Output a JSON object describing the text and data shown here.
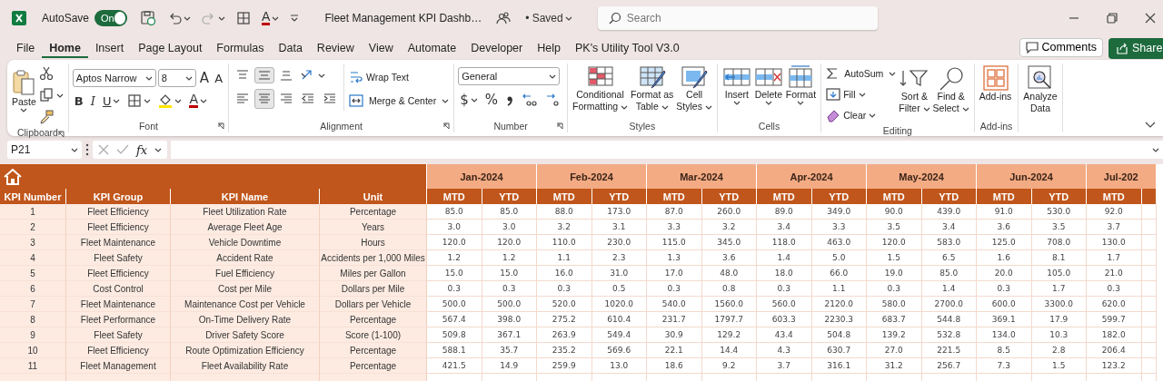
{
  "title_bar": {
    "autosave": {
      "label": "AutoSave",
      "on": true,
      "state_text": "On"
    },
    "font_color": "A",
    "document_title": "Fleet Management KPI Dashb…",
    "save_status": "• Saved",
    "search": {
      "placeholder": "Search"
    }
  },
  "menu_tabs": [
    {
      "label": "File",
      "selected": false
    },
    {
      "label": "Home",
      "selected": true
    },
    {
      "label": "Insert",
      "selected": false
    },
    {
      "label": "Page Layout",
      "selected": false
    },
    {
      "label": "Formulas",
      "selected": false
    },
    {
      "label": "Data",
      "selected": false
    },
    {
      "label": "Review",
      "selected": false
    },
    {
      "label": "View",
      "selected": false
    },
    {
      "label": "Automate",
      "selected": false
    },
    {
      "label": "Developer",
      "selected": false
    },
    {
      "label": "Help",
      "selected": false
    },
    {
      "label": "PK's Utility Tool V3.0",
      "selected": false
    }
  ],
  "comments_button": "Comments",
  "share_button": "Share",
  "ribbon": {
    "clipboard": {
      "label": "Clipboard",
      "paste": "Paste"
    },
    "font": {
      "label": "Font",
      "font_name": "Aptos Narrow",
      "font_size": "8",
      "grow": "A",
      "shrink": "A",
      "bold": "B",
      "italic": "I",
      "underline": "U",
      "font_color": "A"
    },
    "alignment": {
      "label": "Alignment",
      "vertical": [
        {
          "selected": false
        },
        {
          "selected": true
        },
        {
          "selected": false
        }
      ],
      "horizontal": [
        {
          "selected": false
        },
        {
          "selected": true
        },
        {
          "selected": false
        }
      ],
      "wrap_text": "Wrap Text",
      "merge_center": "Merge & Center"
    },
    "number": {
      "label": "Number",
      "format": "General",
      "currency": "$",
      "percent": "%"
    },
    "styles": {
      "label": "Styles",
      "buttons": [
        "Conditional\nFormatting",
        "Format as\nTable",
        "Cell\nStyles"
      ]
    },
    "cells": {
      "label": "Cells",
      "buttons": [
        "Insert",
        "Delete",
        "Format"
      ]
    },
    "editing": {
      "label": "Editing",
      "autosum": "AutoSum",
      "fill": "Fill",
      "clear": "Clear",
      "buttons": [
        "Sort &\nFilter",
        "Find &\nSelect"
      ]
    },
    "addins": {
      "label": "Add-ins",
      "button": "Add-ins"
    },
    "analyze": {
      "button": "Analyze\nData"
    }
  },
  "formula_bar": {
    "name_box": "P21",
    "fx": "fx"
  },
  "sheet": {
    "columns": [
      "KPI Number",
      "KPI Group",
      "KPI Name",
      "Unit"
    ],
    "months": [
      {
        "label": "Jan-2024",
        "columns": [
          "MTD",
          "YTD"
        ]
      },
      {
        "label": "Feb-2024",
        "columns": [
          "MTD",
          "YTD"
        ]
      },
      {
        "label": "Mar-2024",
        "columns": [
          "MTD",
          "YTD"
        ]
      },
      {
        "label": "Apr-2024",
        "columns": [
          "MTD",
          "YTD"
        ]
      },
      {
        "label": "May-2024",
        "columns": [
          "MTD",
          "YTD"
        ]
      },
      {
        "label": "Jun-2024",
        "columns": [
          "MTD",
          "YTD"
        ]
      },
      {
        "label": "Jul-202",
        "columns": [
          "MTD"
        ]
      }
    ],
    "rows": [
      {
        "number": "1",
        "group": "Fleet Efficiency",
        "name": "Fleet Utilization Rate",
        "unit": "Percentage",
        "values": [
          "85.0",
          "85.0",
          "88.0",
          "173.0",
          "87.0",
          "260.0",
          "89.0",
          "349.0",
          "90.0",
          "439.0",
          "91.0",
          "530.0",
          "92.0"
        ]
      },
      {
        "number": "2",
        "group": "Fleet Efficiency",
        "name": "Average Fleet Age",
        "unit": "Years",
        "values": [
          "3.0",
          "3.0",
          "3.2",
          "3.1",
          "3.3",
          "3.2",
          "3.4",
          "3.3",
          "3.5",
          "3.4",
          "3.6",
          "3.5",
          "3.7"
        ]
      },
      {
        "number": "3",
        "group": "Fleet Maintenance",
        "name": "Vehicle Downtime",
        "unit": "Hours",
        "values": [
          "120.0",
          "120.0",
          "110.0",
          "230.0",
          "115.0",
          "345.0",
          "118.0",
          "463.0",
          "120.0",
          "583.0",
          "125.0",
          "708.0",
          "130.0"
        ]
      },
      {
        "number": "4",
        "group": "Fleet Safety",
        "name": "Accident Rate",
        "unit": "Accidents per 1,000 Miles",
        "values": [
          "1.2",
          "1.2",
          "1.1",
          "2.3",
          "1.3",
          "3.6",
          "1.4",
          "5.0",
          "1.5",
          "6.5",
          "1.6",
          "8.1",
          "1.7"
        ]
      },
      {
        "number": "5",
        "group": "Fleet Efficiency",
        "name": "Fuel Efficiency",
        "unit": "Miles per Gallon",
        "values": [
          "15.0",
          "15.0",
          "16.0",
          "31.0",
          "17.0",
          "48.0",
          "18.0",
          "66.0",
          "19.0",
          "85.0",
          "20.0",
          "105.0",
          "21.0"
        ]
      },
      {
        "number": "6",
        "group": "Cost Control",
        "name": "Cost per Mile",
        "unit": "Dollars per Mile",
        "values": [
          "0.3",
          "0.3",
          "0.3",
          "0.5",
          "0.3",
          "0.8",
          "0.3",
          "1.1",
          "0.3",
          "1.4",
          "0.3",
          "1.7",
          "0.3"
        ]
      },
      {
        "number": "7",
        "group": "Fleet Maintenance",
        "name": "Maintenance Cost per Vehicle",
        "unit": "Dollars per Vehicle",
        "values": [
          "500.0",
          "500.0",
          "520.0",
          "1020.0",
          "540.0",
          "1560.0",
          "560.0",
          "2120.0",
          "580.0",
          "2700.0",
          "600.0",
          "3300.0",
          "620.0"
        ]
      },
      {
        "number": "8",
        "group": "Fleet Performance",
        "name": "On-Time Delivery Rate",
        "unit": "Percentage",
        "values": [
          "567.4",
          "398.0",
          "275.2",
          "610.4",
          "231.7",
          "1797.7",
          "603.3",
          "2230.3",
          "683.7",
          "544.8",
          "369.1",
          "17.9",
          "599.7"
        ]
      },
      {
        "number": "9",
        "group": "Fleet Safety",
        "name": "Driver Safety Score",
        "unit": "Score (1-100)",
        "values": [
          "509.8",
          "367.1",
          "263.9",
          "549.4",
          "30.9",
          "129.2",
          "43.4",
          "504.8",
          "139.2",
          "532.8",
          "134.0",
          "10.3",
          "182.0"
        ]
      },
      {
        "number": "10",
        "group": "Fleet Efficiency",
        "name": "Route Optimization Efficiency",
        "unit": "Percentage",
        "values": [
          "588.1",
          "35.7",
          "235.2",
          "569.6",
          "22.1",
          "14.4",
          "4.3",
          "630.7",
          "27.0",
          "221.5",
          "8.5",
          "2.8",
          "206.4"
        ]
      },
      {
        "number": "11",
        "group": "Fleet Management",
        "name": "Fleet Availability Rate",
        "unit": "Percentage",
        "values": [
          "421.5",
          "14.9",
          "259.9",
          "13.0",
          "18.6",
          "9.2",
          "3.7",
          "316.1",
          "31.2",
          "256.7",
          "7.3",
          "1.5",
          "123.2"
        ]
      }
    ]
  }
}
